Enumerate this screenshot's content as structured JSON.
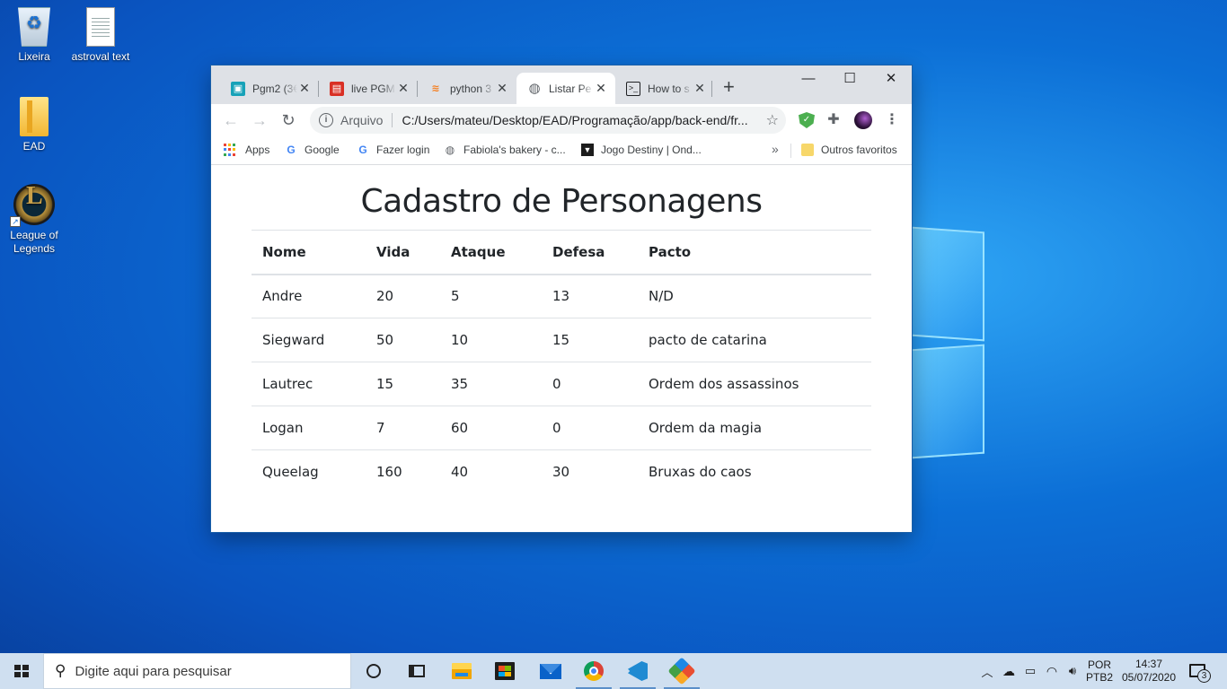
{
  "desktop": {
    "icons": [
      {
        "label": "Lixeira",
        "icon": "recycle-bin-icon"
      },
      {
        "label": "astroval text",
        "icon": "text-file-icon"
      },
      {
        "label": "EAD",
        "icon": "folder-icon"
      },
      {
        "label": "League of Legends",
        "icon": "league-of-legends-icon"
      }
    ]
  },
  "browser": {
    "tabs": [
      {
        "title": "Pgm2 (3€",
        "favicon": "classroom-icon",
        "color": "#17a2b8",
        "active": false
      },
      {
        "title": "live PGM",
        "favicon": "video-icon",
        "color": "#d93025",
        "active": false
      },
      {
        "title": "python 3",
        "favicon": "stackoverflow-icon",
        "color": "#f48024",
        "active": false
      },
      {
        "title": "Listar Pe",
        "favicon": "globe-icon",
        "color": "#5f6368",
        "active": true
      },
      {
        "title": "How to s",
        "favicon": "terminal-icon",
        "color": "#202124",
        "active": false
      }
    ],
    "new_tab_label": "+",
    "window_controls": {
      "minimize": "—",
      "maximize": "☐",
      "close": "✕"
    },
    "address": {
      "chip": "Arquivo",
      "url": "C:/Users/mateu/Desktop/EAD/Programação/app/back-end/fr..."
    },
    "bookmarks": [
      {
        "label": "Apps",
        "icon": "apps-grid-icon"
      },
      {
        "label": "Google",
        "icon": "google-icon"
      },
      {
        "label": "Fazer login",
        "icon": "google-icon"
      },
      {
        "label": "Fabiola's bakery - c...",
        "icon": "globe-icon"
      },
      {
        "label": "Jogo Destiny | Ond...",
        "icon": "destiny-icon"
      }
    ],
    "bookmarks_more": "»",
    "other_bookmarks": "Outros favoritos"
  },
  "page": {
    "title": "Cadastro de Personagens",
    "table": {
      "headers": [
        "Nome",
        "Vida",
        "Ataque",
        "Defesa",
        "Pacto"
      ],
      "rows": [
        [
          "Andre",
          "20",
          "5",
          "13",
          "N/D"
        ],
        [
          "Siegward",
          "50",
          "10",
          "15",
          "pacto de catarina"
        ],
        [
          "Lautrec",
          "15",
          "35",
          "0",
          "Ordem dos assassinos"
        ],
        [
          "Logan",
          "7",
          "60",
          "0",
          "Ordem da magia"
        ],
        [
          "Queelag",
          "160",
          "40",
          "30",
          "Bruxas do caos"
        ]
      ]
    }
  },
  "taskbar": {
    "search_placeholder": "Digite aqui para pesquisar",
    "apps": [
      "cortana-icon",
      "task-view-icon",
      "file-explorer-icon",
      "store-icon",
      "mail-icon",
      "chrome-icon",
      "vscode-icon",
      "git-icon"
    ],
    "lang_top": "POR",
    "lang_bottom": "PTB2",
    "time": "14:37",
    "date": "05/07/2020",
    "notification_count": "3"
  }
}
